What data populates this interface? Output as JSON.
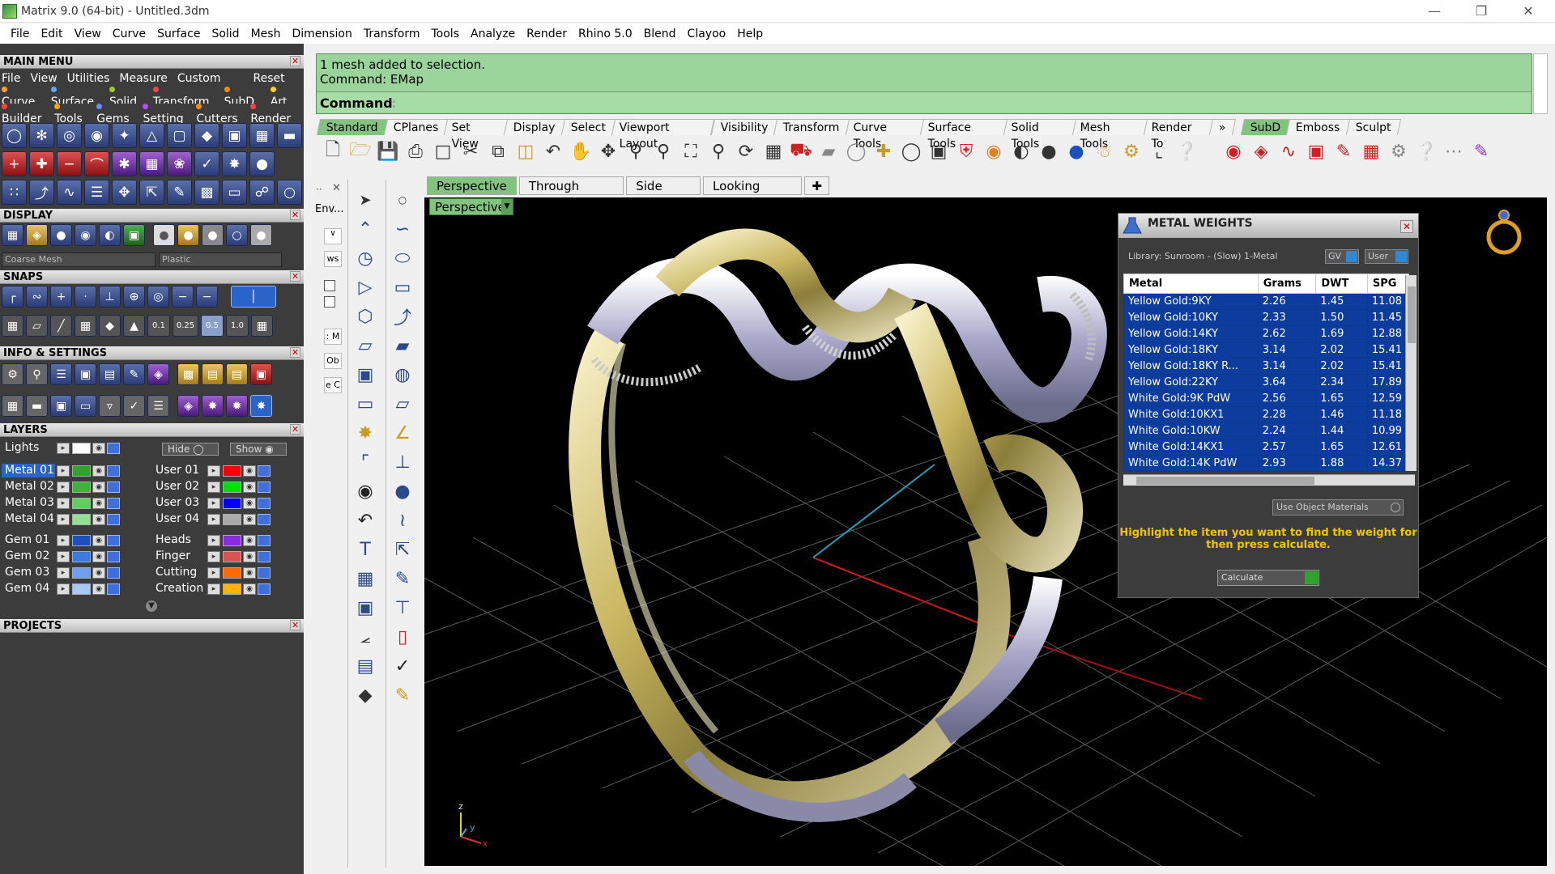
{
  "window": {
    "title": "Matrix 9.0 (64-bit) - Untitled.3dm"
  },
  "menubar": [
    "File",
    "Edit",
    "View",
    "Curve",
    "Surface",
    "Solid",
    "Mesh",
    "Dimension",
    "Transform",
    "Tools",
    "Analyze",
    "Render",
    "Rhino 5.0",
    "Blend",
    "Clayoo",
    "Help"
  ],
  "main_menu": {
    "title": "MAIN MENU",
    "menu": [
      "File",
      "View",
      "Utilities",
      "Measure",
      "Custom"
    ],
    "reset": "Reset",
    "row2": [
      {
        "label": "Curve",
        "color": "#ff9d2e"
      },
      {
        "label": "Surface",
        "color": "#66a3ff"
      },
      {
        "label": "Solid",
        "color": "#9acd32"
      },
      {
        "label": "Transform",
        "color": "#ff4040"
      },
      {
        "label": "SubD",
        "color": "#ff8c00"
      },
      {
        "label": "Art",
        "color": "#ffd700"
      }
    ],
    "row3": [
      {
        "label": "Builder",
        "color": "#ff4040"
      },
      {
        "label": "Tools",
        "color": "#ffa500"
      },
      {
        "label": "Gems",
        "color": "#6a8cff"
      },
      {
        "label": "Setting",
        "color": "#b84dff"
      },
      {
        "label": "Cutters",
        "color": "#ff8c00"
      },
      {
        "label": "Render",
        "color": "#ff4040"
      }
    ]
  },
  "display": {
    "title": "DISPLAY",
    "mesh_dropdown": "Coarse Mesh",
    "material_dropdown": "Plastic"
  },
  "snaps": {
    "title": "SNAPS",
    "values": [
      "0.1",
      "0.25",
      "0.5",
      "1.0"
    ]
  },
  "info_settings": {
    "title": "INFO & SETTINGS"
  },
  "layers": {
    "title": "LAYERS",
    "lights": "Lights",
    "hide": "Hide",
    "show": "Show",
    "left": [
      {
        "name": "Metal 01",
        "color": "#2fa52f"
      },
      {
        "name": "Metal 02",
        "color": "#3cb43c"
      },
      {
        "name": "Metal 03",
        "color": "#5fce5f"
      },
      {
        "name": "Metal 04",
        "color": "#92e092"
      },
      {
        "name": "Gem 01",
        "color": "#1d4fbf"
      },
      {
        "name": "Gem 02",
        "color": "#3d7ae0"
      },
      {
        "name": "Gem 03",
        "color": "#6fa0ee"
      },
      {
        "name": "Gem 04",
        "color": "#a9c8f5"
      }
    ],
    "right": [
      {
        "name": "User 01",
        "color": "#ff0000"
      },
      {
        "name": "User 02",
        "color": "#00e000"
      },
      {
        "name": "User 03",
        "color": "#0000ff"
      },
      {
        "name": "User 04",
        "color": "#aaaaaa"
      },
      {
        "name": "Heads",
        "color": "#8a2be2"
      },
      {
        "name": "Finger",
        "color": "#d9534f"
      },
      {
        "name": "Cutting",
        "color": "#ff6a00"
      },
      {
        "name": "Creation",
        "color": "#ffb300"
      }
    ]
  },
  "projects": {
    "title": "PROJECTS"
  },
  "command": {
    "line1": "1 mesh added to selection.",
    "line2": "Command: EMap",
    "label": "Command:",
    "input": ""
  },
  "toolbar_tabs": [
    "Standard",
    "CPlanes",
    "Set View",
    "Display",
    "Select",
    "Viewport Layout",
    "Visibility",
    "Transform",
    "Curve Tools",
    "Surface Tools",
    "Solid Tools",
    "Mesh Tools",
    "Render To"
  ],
  "toolbar_tabs_right": [
    "SubD",
    "Emboss",
    "Sculpt"
  ],
  "sidebar_labels": {
    "env": "Env...",
    "ws": "ws",
    "m": ": M",
    "ob": "Ob",
    "ec": "e C"
  },
  "viewport_tabs": [
    "Perspective",
    "Through Finger",
    "Side View",
    "Looking Down"
  ],
  "viewport": {
    "label": "Perspective",
    "axis_z": "z",
    "axis_y": "y",
    "axis_x": "x"
  },
  "metal_weights": {
    "title": "METAL WEIGHTS",
    "library": "Library: Sunroom - (Slow) 1-Metal",
    "gv": "GV",
    "user": "User",
    "columns": [
      "Metal",
      "Grams",
      "DWT",
      "SPG"
    ],
    "rows": [
      [
        "Yellow Gold:9KY",
        "2.26",
        "1.45",
        "11.08"
      ],
      [
        "Yellow Gold:10KY",
        "2.33",
        "1.50",
        "11.45"
      ],
      [
        "Yellow Gold:14KY",
        "2.62",
        "1.69",
        "12.88"
      ],
      [
        "Yellow Gold:18KY",
        "3.14",
        "2.02",
        "15.41"
      ],
      [
        "Yellow Gold:18KY R...",
        "3.14",
        "2.02",
        "15.41"
      ],
      [
        "Yellow Gold:22KY",
        "3.64",
        "2.34",
        "17.89"
      ],
      [
        "White Gold:9K PdW",
        "2.56",
        "1.65",
        "12.59"
      ],
      [
        "White Gold:10KX1",
        "2.28",
        "1.46",
        "11.18"
      ],
      [
        "White Gold:10KW",
        "2.24",
        "1.44",
        "10.99"
      ],
      [
        "White Gold:14KX1",
        "2.57",
        "1.65",
        "12.61"
      ],
      [
        "White Gold:14K PdW",
        "2.93",
        "1.88",
        "14.37"
      ]
    ],
    "use_object_materials": "Use Object Materials",
    "hint": "Highlight the item you want to find the weight for then press calculate.",
    "calculate": "Calculate"
  }
}
